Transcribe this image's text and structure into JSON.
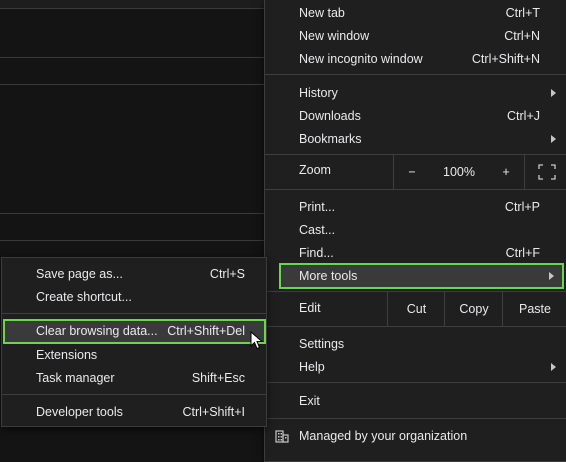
{
  "menu": {
    "new_tab": {
      "label": "New tab",
      "shortcut": "Ctrl+T"
    },
    "new_window": {
      "label": "New window",
      "shortcut": "Ctrl+N"
    },
    "new_incognito": {
      "label": "New incognito window",
      "shortcut": "Ctrl+Shift+N"
    },
    "history": {
      "label": "History"
    },
    "downloads": {
      "label": "Downloads",
      "shortcut": "Ctrl+J"
    },
    "bookmarks": {
      "label": "Bookmarks"
    },
    "zoom": {
      "label": "Zoom",
      "minus": "−",
      "value": "100%",
      "plus": "+"
    },
    "print": {
      "label": "Print...",
      "shortcut": "Ctrl+P"
    },
    "cast": {
      "label": "Cast..."
    },
    "find": {
      "label": "Find...",
      "shortcut": "Ctrl+F"
    },
    "more_tools": {
      "label": "More tools"
    },
    "edit": {
      "label": "Edit",
      "cut": "Cut",
      "copy": "Copy",
      "paste": "Paste"
    },
    "settings": {
      "label": "Settings"
    },
    "help": {
      "label": "Help"
    },
    "exit": {
      "label": "Exit"
    },
    "managed": {
      "label": "Managed by your organization"
    }
  },
  "submenu": {
    "save_page": {
      "label": "Save page as...",
      "shortcut": "Ctrl+S"
    },
    "create_shortcut": {
      "label": "Create shortcut..."
    },
    "clear_data": {
      "label": "Clear browsing data...",
      "shortcut": "Ctrl+Shift+Del"
    },
    "extensions": {
      "label": "Extensions"
    },
    "task_manager": {
      "label": "Task manager",
      "shortcut": "Shift+Esc"
    },
    "dev_tools": {
      "label": "Developer tools",
      "shortcut": "Ctrl+Shift+I"
    }
  },
  "highlight_color": "#6bd54e"
}
